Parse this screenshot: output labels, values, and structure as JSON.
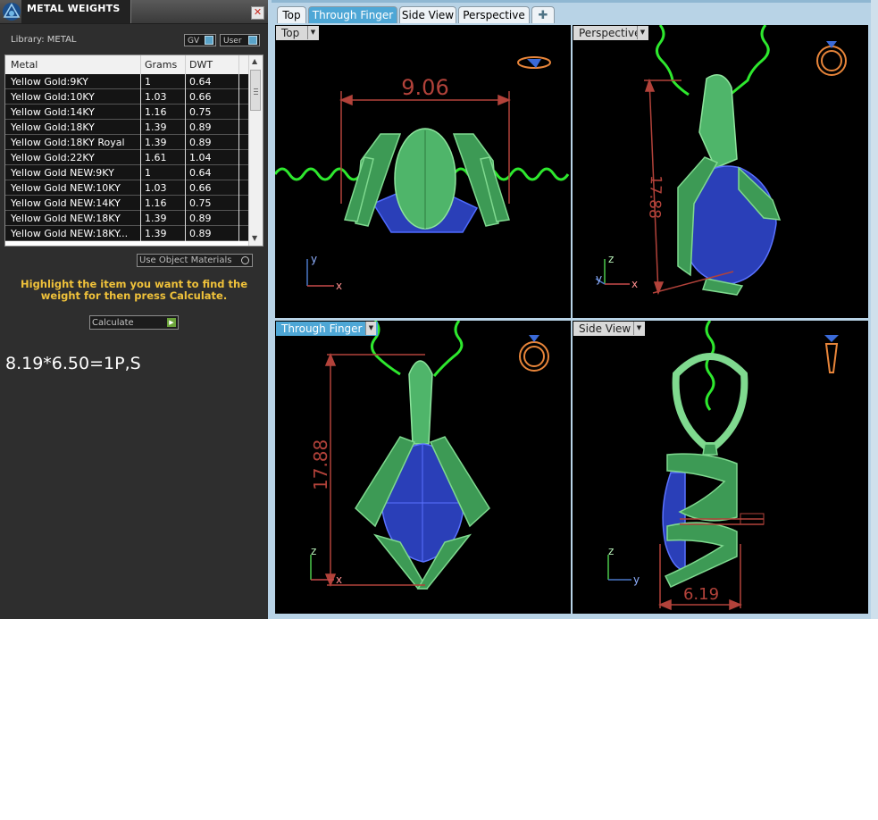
{
  "panel": {
    "title": "METAL WEIGHTS",
    "library_label": "Library: METAL",
    "gv_label": "GV",
    "user_label": "User",
    "close_glyph": "✕",
    "app_icon": "app-logo-icon",
    "columns": [
      "Metal",
      "Grams",
      "DWT"
    ],
    "rows": [
      {
        "metal": "Yellow Gold:9KY",
        "grams": "1",
        "dwt": "0.64"
      },
      {
        "metal": "Yellow Gold:10KY",
        "grams": "1.03",
        "dwt": "0.66"
      },
      {
        "metal": "Yellow Gold:14KY",
        "grams": "1.16",
        "dwt": "0.75"
      },
      {
        "metal": "Yellow Gold:18KY",
        "grams": "1.39",
        "dwt": "0.89"
      },
      {
        "metal": "Yellow Gold:18KY Royal",
        "grams": "1.39",
        "dwt": "0.89"
      },
      {
        "metal": "Yellow Gold:22KY",
        "grams": "1.61",
        "dwt": "1.04"
      },
      {
        "metal": "Yellow Gold NEW:9KY",
        "grams": "1",
        "dwt": "0.64"
      },
      {
        "metal": "Yellow Gold NEW:10KY",
        "grams": "1.03",
        "dwt": "0.66"
      },
      {
        "metal": "Yellow Gold NEW:14KY",
        "grams": "1.16",
        "dwt": "0.75"
      },
      {
        "metal": "Yellow Gold NEW:18KY",
        "grams": "1.39",
        "dwt": "0.89"
      },
      {
        "metal": "Yellow Gold NEW:18KY...",
        "grams": "1.39",
        "dwt": "0.89"
      }
    ],
    "use_object_materials": "Use Object Materials",
    "hint": "Highlight the item you want to find the weight for then press Calculate.",
    "calculate_label": "Calculate",
    "note": "8.19*6.50=1P,S"
  },
  "tabs": [
    {
      "label": "Top",
      "active": false
    },
    {
      "label": "Through Finger",
      "active": true
    },
    {
      "label": "Side View",
      "active": false
    },
    {
      "label": "Perspective",
      "active": false
    }
  ],
  "add_tab_glyph": "✚",
  "viewports": {
    "top": {
      "label": "Top",
      "active": false,
      "dimension": "9.06",
      "axis_x": "x",
      "axis_y": "y"
    },
    "perspective": {
      "label": "Perspective",
      "active": false,
      "dimension": "17.88",
      "axis_x": "x",
      "axis_y": "y",
      "axis_z": "z"
    },
    "through_finger": {
      "label": "Through Finger",
      "active": true,
      "dimension": "17.88",
      "axis_x": "x",
      "axis_z": "z"
    },
    "side_view": {
      "label": "Side View",
      "active": false,
      "dimension": "6.19",
      "axis_y": "y",
      "axis_z": "z"
    }
  },
  "colors": {
    "panel_bg": "#2e2e2e",
    "hint_text": "#f0c23a",
    "metal_green": "#4fb56a",
    "chain_green": "#2ee82e",
    "gem_blue": "#2a3fb8",
    "dimension_red": "#b2423a",
    "active_tab": "#4ea7d6",
    "viewport_bg": "#000000"
  }
}
